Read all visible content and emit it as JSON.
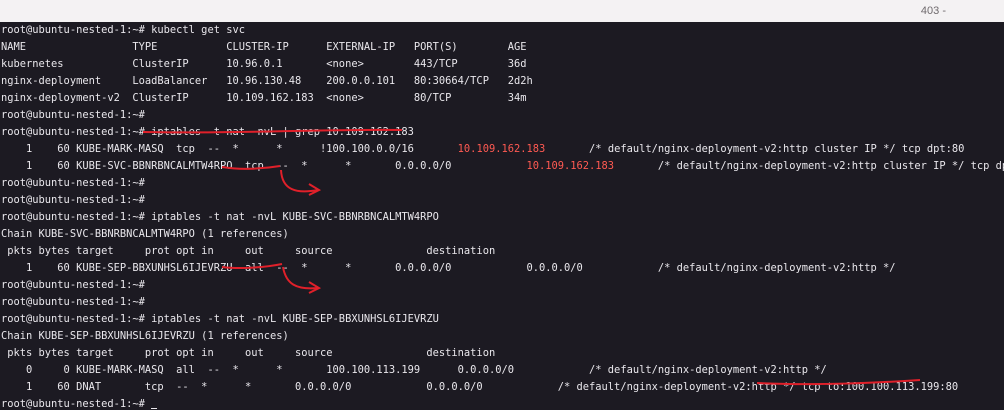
{
  "header": {
    "page_number": "403 -"
  },
  "terminal": {
    "lines": [
      "root@ubuntu-nested-1:~# kubectl get svc",
      "NAME                 TYPE           CLUSTER-IP      EXTERNAL-IP   PORT(S)        AGE",
      "kubernetes           ClusterIP      10.96.0.1       <none>        443/TCP        36d",
      "nginx-deployment     LoadBalancer   10.96.130.48    200.0.0.101   80:30664/TCP   2d2h",
      "nginx-deployment-v2  ClusterIP      10.109.162.183  <none>        80/TCP         34m",
      "root@ubuntu-nested-1:~#",
      "root@ubuntu-nested-1:~# iptables -t nat -nvL | grep 10.109.162.183",
      "",
      "",
      "root@ubuntu-nested-1:~#",
      "root@ubuntu-nested-1:~#",
      "root@ubuntu-nested-1:~# iptables -t nat -nvL KUBE-SVC-BBNRBNCALMTW4RPO",
      "Chain KUBE-SVC-BBNRBNCALMTW4RPO (1 references)",
      " pkts bytes target     prot opt in     out     source               destination",
      "    1    60 KUBE-SEP-BBXUNHSL6IJEVRZU  all  --  *      *       0.0.0.0/0            0.0.0.0/0            /* default/nginx-deployment-v2:http */",
      "root@ubuntu-nested-1:~#",
      "root@ubuntu-nested-1:~#",
      "root@ubuntu-nested-1:~# iptables -t nat -nvL KUBE-SEP-BBXUNHSL6IJEVRZU",
      "Chain KUBE-SEP-BBXUNHSL6IJEVRZU (1 references)",
      " pkts bytes target     prot opt in     out     source               destination",
      "    0     0 KUBE-MARK-MASQ  all  --  *      *       100.100.113.199      0.0.0.0/0            /* default/nginx-deployment-v2:http */",
      "    1    60 DNAT       tcp  --  *      *       0.0.0.0/0            0.0.0.0/0            /* default/nginx-deployment-v2:http */ tcp to:100.100.113.199:80",
      "root@ubuntu-nested-1:~# "
    ],
    "grep_line_1": {
      "prefix": "    1    60 KUBE-MARK-MASQ  tcp  --  *      *      !100.100.0.0/16       ",
      "ip": "10.109.162.183",
      "suffix": "       /* default/nginx-deployment-v2:http cluster IP */ tcp dpt:80"
    },
    "grep_line_2": {
      "prefix": "    1    60 KUBE-SVC-BBNRBNCALMTW4RPO  tcp  --  *      *       0.0.0.0/0            ",
      "ip": "10.109.162.183",
      "suffix": "       /* default/nginx-deployment-v2:http cluster IP */ tcp dpt:80"
    }
  },
  "colors": {
    "background": "#1c1a22",
    "text": "#e9e7ec",
    "highlight": "#ff5a52",
    "annotation": "#e0202a"
  }
}
